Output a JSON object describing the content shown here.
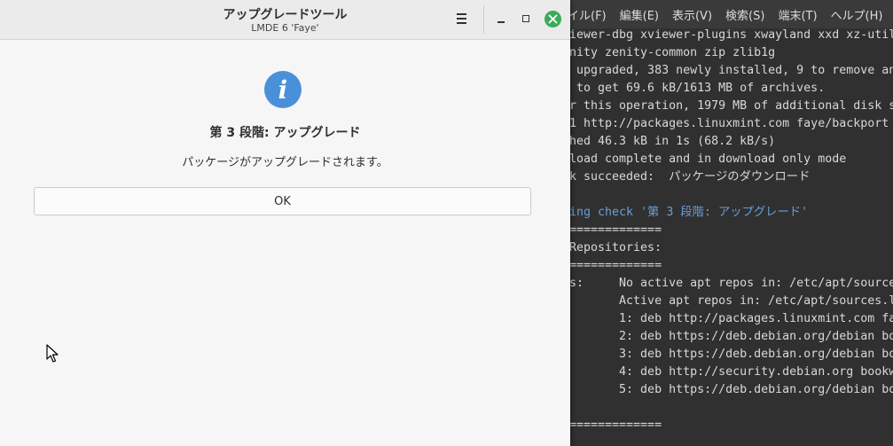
{
  "dialog": {
    "title": "アップグレードツール",
    "subtitle": "LMDE 6 'Faye'",
    "heading": "第 3 段階: アップグレード",
    "message": "パッケージがアップグレードされます。",
    "ok_label": "OK",
    "icon": "info-icon",
    "close_color": "#3daa5a",
    "icon_color": "#4a90d9"
  },
  "terminal": {
    "menu": [
      "イル(F)",
      "編集(E)",
      "表示(V)",
      "検索(S)",
      "端末(T)",
      "ヘルプ(H)"
    ],
    "lines": [
      {
        "text": "iewer-dbg xviewer-plugins xwayland xxd xz-util",
        "blue": false
      },
      {
        "text": "nity zenity-common zip zlib1g",
        "blue": false
      },
      {
        "text": " upgraded, 383 newly installed, 9 to remove an",
        "blue": false
      },
      {
        "text": " to get 69.6 kB/1613 MB of archives.",
        "blue": false
      },
      {
        "text": "r this operation, 1979 MB of additional disk s",
        "blue": false
      },
      {
        "text": "1 http://packages.linuxmint.com faye/backport",
        "blue": false
      },
      {
        "text": "hed 46.3 kB in 1s (68.2 kB/s)",
        "blue": false
      },
      {
        "text": "load complete and in download only mode",
        "blue": false
      },
      {
        "text": "k succeeded:  パッケージのダウンロード",
        "blue": false
      },
      {
        "text": "",
        "blue": false
      },
      {
        "text": "ing check '第 3 段階: アップグレード'",
        "blue": true
      },
      {
        "text": "=============",
        "blue": false
      },
      {
        "text": "Repositories:",
        "blue": false
      },
      {
        "text": "=============",
        "blue": false
      },
      {
        "text": "s:     No active apt repos in: /etc/apt/source",
        "blue": false
      },
      {
        "text": "       Active apt repos in: /etc/apt/sources.l",
        "blue": false
      },
      {
        "text": "       1: deb http://packages.linuxmint.com fa",
        "blue": false
      },
      {
        "text": "       2: deb https://deb.debian.org/debian bo",
        "blue": false
      },
      {
        "text": "       3: deb https://deb.debian.org/debian bo",
        "blue": false
      },
      {
        "text": "       4: deb http://security.debian.org bookw",
        "blue": false
      },
      {
        "text": "       5: deb https://deb.debian.org/debian bo",
        "blue": false
      },
      {
        "text": "",
        "blue": false
      },
      {
        "text": "=============",
        "blue": false
      }
    ]
  }
}
